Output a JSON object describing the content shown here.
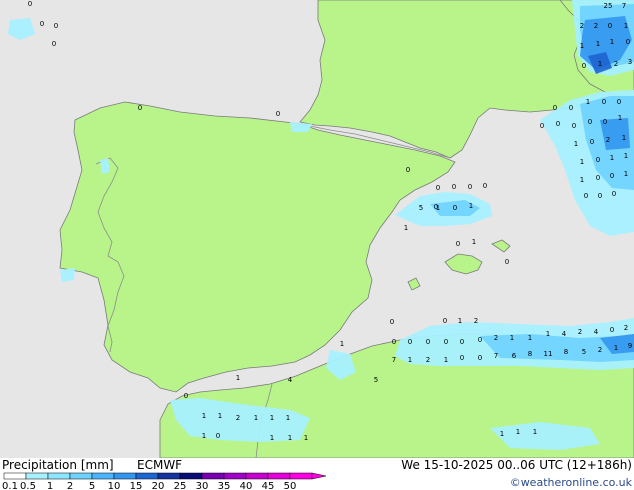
{
  "colors": {
    "sea": "#e6e6e6",
    "land": "#b9f48b",
    "border": "#8c8c8c",
    "coast": "#7a7a7a"
  },
  "footer": {
    "title": "Precipitation [mm]",
    "model": "ECMWF",
    "valid_time": "We 15-10-2025 00..06 UTC (12+186h)",
    "credit": "©weatheronline.co.uk"
  },
  "legend": {
    "ticks": [
      "0.1",
      "0.5",
      "1",
      "2",
      "5",
      "10",
      "15",
      "20",
      "25",
      "30",
      "35",
      "40",
      "45",
      "50"
    ],
    "colors": [
      "#ffffff",
      "#a6f0ff",
      "#8ce6ff",
      "#6ed2ff",
      "#4ab4ff",
      "#3296f0",
      "#1e64d2",
      "#1432a0",
      "#0a0a78",
      "#7800b4",
      "#a000c8",
      "#c800d2",
      "#e600dc",
      "#ff00e6"
    ]
  },
  "precip_values": [
    "0",
    "0",
    "0",
    "0",
    "0",
    "0",
    "0",
    "0",
    "0",
    "0",
    "0",
    "0",
    "0",
    "0",
    "1",
    "2",
    "5",
    "1",
    "0",
    "1",
    "1",
    "0",
    "1",
    "0",
    "0",
    "0",
    "0",
    "0",
    "1",
    "0",
    "0",
    "0",
    "0",
    "0",
    "1",
    "1",
    "0",
    "2",
    "1",
    "1",
    "0",
    "1",
    "1",
    "1",
    "0",
    "0",
    "1",
    "0",
    "0",
    "0",
    "0",
    "0",
    "0",
    "0",
    "0",
    "0",
    "2",
    "1",
    "1",
    "1",
    "4",
    "2",
    "4",
    "0",
    "2",
    "7",
    "1",
    "2",
    "1",
    "0",
    "0",
    "7",
    "6",
    "8",
    "11",
    "8",
    "5",
    "2",
    "1",
    "9",
    "25",
    "7",
    "2",
    "2",
    "0",
    "1",
    "1",
    "1",
    "1",
    "0",
    "0",
    "1",
    "2",
    "3",
    "1",
    "1",
    "4",
    "5",
    "0",
    "1",
    "1",
    "2",
    "1",
    "1",
    "1",
    "1",
    "0",
    "1",
    "1",
    "1",
    "1",
    "1",
    "1"
  ]
}
